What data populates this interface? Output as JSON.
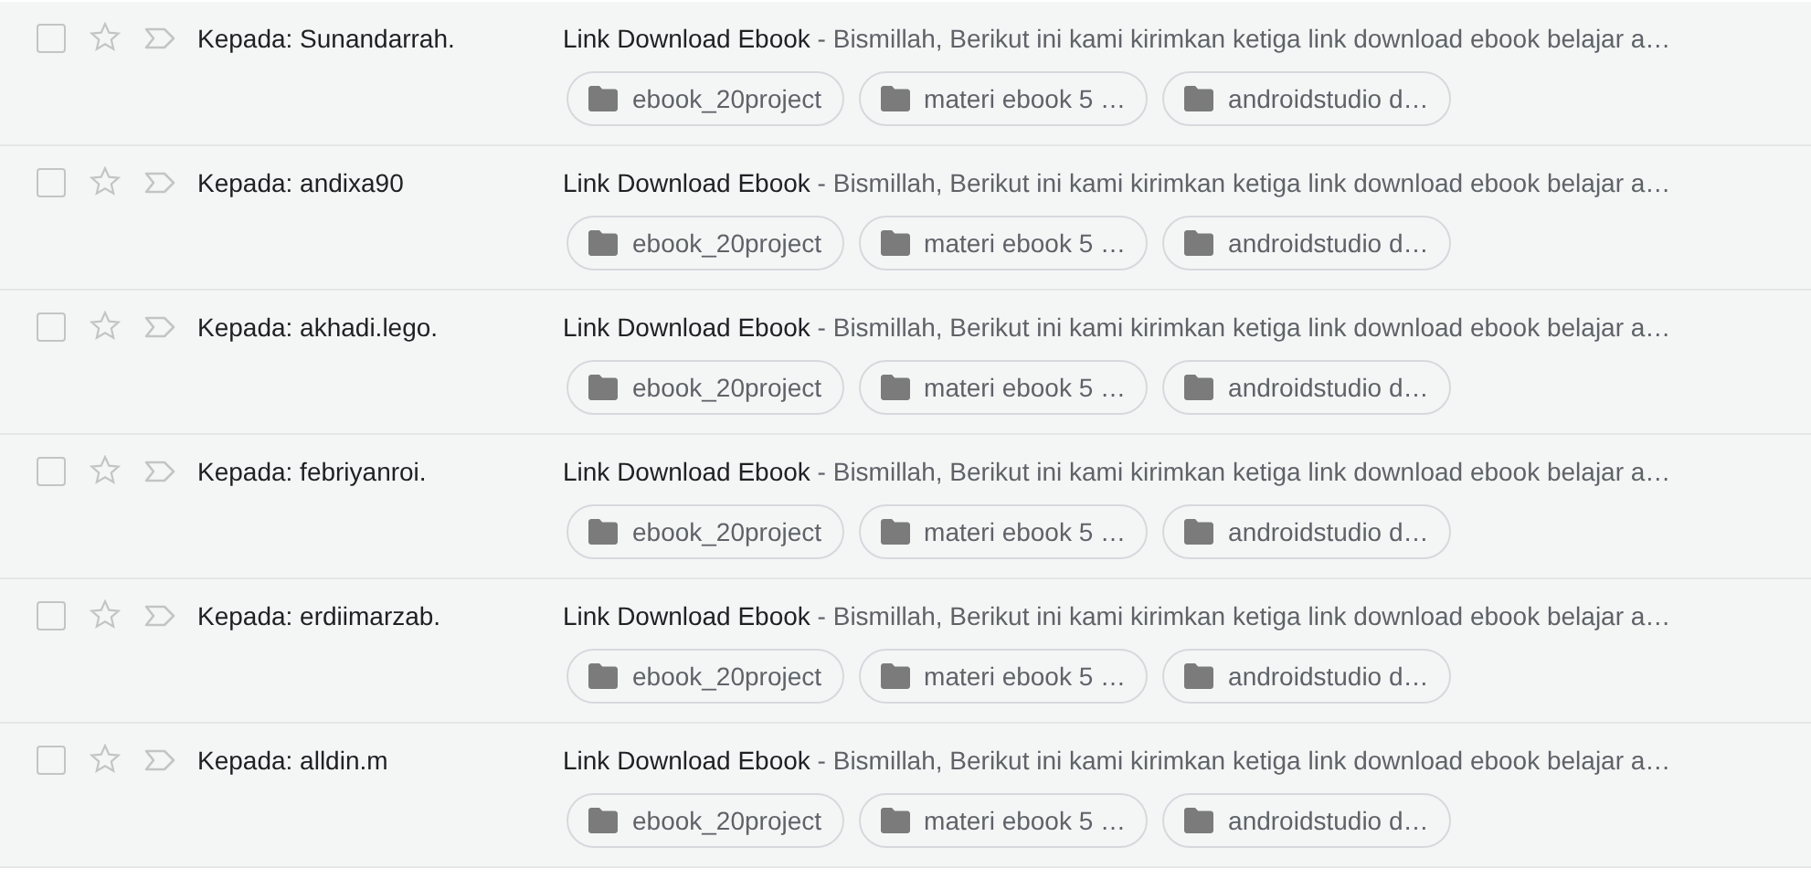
{
  "messages": [
    {
      "recipient": "Kepada: Sunandarrah.",
      "subject": "Link Download Ebook",
      "snippet": " - Bismillah, Berikut ini kami kirimkan ketiga link download ebook belajar a…",
      "checked": false,
      "starred": false,
      "important": false,
      "attachments": [
        "ebook_20project",
        "materi ebook 5 …",
        "androidstudio d…"
      ]
    },
    {
      "recipient": "Kepada: andixa90",
      "subject": "Link Download Ebook",
      "snippet": " - Bismillah, Berikut ini kami kirimkan ketiga link download ebook belajar a…",
      "checked": false,
      "starred": false,
      "important": false,
      "attachments": [
        "ebook_20project",
        "materi ebook 5 …",
        "androidstudio d…"
      ]
    },
    {
      "recipient": "Kepada: akhadi.lego.",
      "subject": "Link Download Ebook",
      "snippet": " - Bismillah, Berikut ini kami kirimkan ketiga link download ebook belajar a…",
      "checked": false,
      "starred": false,
      "important": false,
      "attachments": [
        "ebook_20project",
        "materi ebook 5 …",
        "androidstudio d…"
      ]
    },
    {
      "recipient": "Kepada: febriyanroi.",
      "subject": "Link Download Ebook",
      "snippet": " - Bismillah, Berikut ini kami kirimkan ketiga link download ebook belajar a…",
      "checked": false,
      "starred": false,
      "important": false,
      "attachments": [
        "ebook_20project",
        "materi ebook 5 …",
        "androidstudio d…"
      ]
    },
    {
      "recipient": "Kepada: erdiimarzab.",
      "subject": "Link Download Ebook",
      "snippet": " - Bismillah, Berikut ini kami kirimkan ketiga link download ebook belajar a…",
      "checked": false,
      "starred": false,
      "important": false,
      "attachments": [
        "ebook_20project",
        "materi ebook 5 …",
        "androidstudio d…"
      ]
    },
    {
      "recipient": "Kepada: alldin.m",
      "subject": "Link Download Ebook",
      "snippet": " - Bismillah, Berikut ini kami kirimkan ketiga link download ebook belajar a…",
      "checked": false,
      "starred": false,
      "important": false,
      "attachments": [
        "ebook_20project",
        "materi ebook 5 …",
        "androidstudio d…"
      ]
    }
  ]
}
